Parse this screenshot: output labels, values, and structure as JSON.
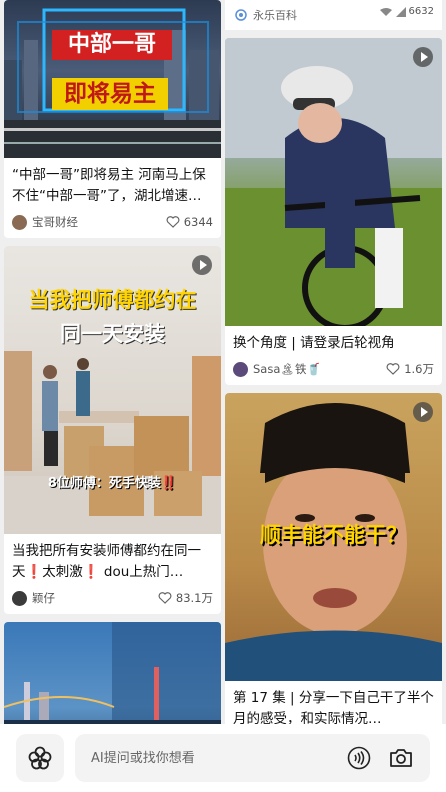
{
  "feed": {
    "left": [
      {
        "overlay_line1": "中部一哥",
        "overlay_line2": "即将易主",
        "title": "“中部一哥”即将易主 河南马上保不住“中部一哥”了，湖北增速…",
        "author": "宝哥财经",
        "likes": "6344",
        "has_play": false
      },
      {
        "overlay_line1": "当我把师傅都约在",
        "overlay_line2": "同一天安装",
        "overlay_line3": "8位师傅：死手快装‼️",
        "title": "当我把所有安装师傅都约在同一天❗太刺激❗ dou上热门…",
        "author": "颖仔",
        "likes": "83.1万",
        "has_play": true
      },
      {
        "title": "",
        "has_play": false
      }
    ],
    "right": [
      {
        "source": "永乐百科",
        "status": "6632"
      },
      {
        "title": "换个角度 | 请登录后轮视角",
        "author": "Sasa🏝铁🥤",
        "likes": "1.6万",
        "has_play": true
      },
      {
        "overlay_line1": "顺丰能不能干？",
        "title": "第 17 集 | 分享一下自己干了半个月的感受，和实际情况…",
        "has_play": true
      }
    ]
  },
  "search": {
    "placeholder": "AI提问或找你想看"
  },
  "colors": {
    "accent_red": "#e02020",
    "overlay_yellow": "#ffd400"
  },
  "icons": {
    "logo": "baidu-flower-icon",
    "voice": "voice-icon",
    "camera": "camera-icon",
    "heart": "heart-icon",
    "play": "play-icon"
  }
}
